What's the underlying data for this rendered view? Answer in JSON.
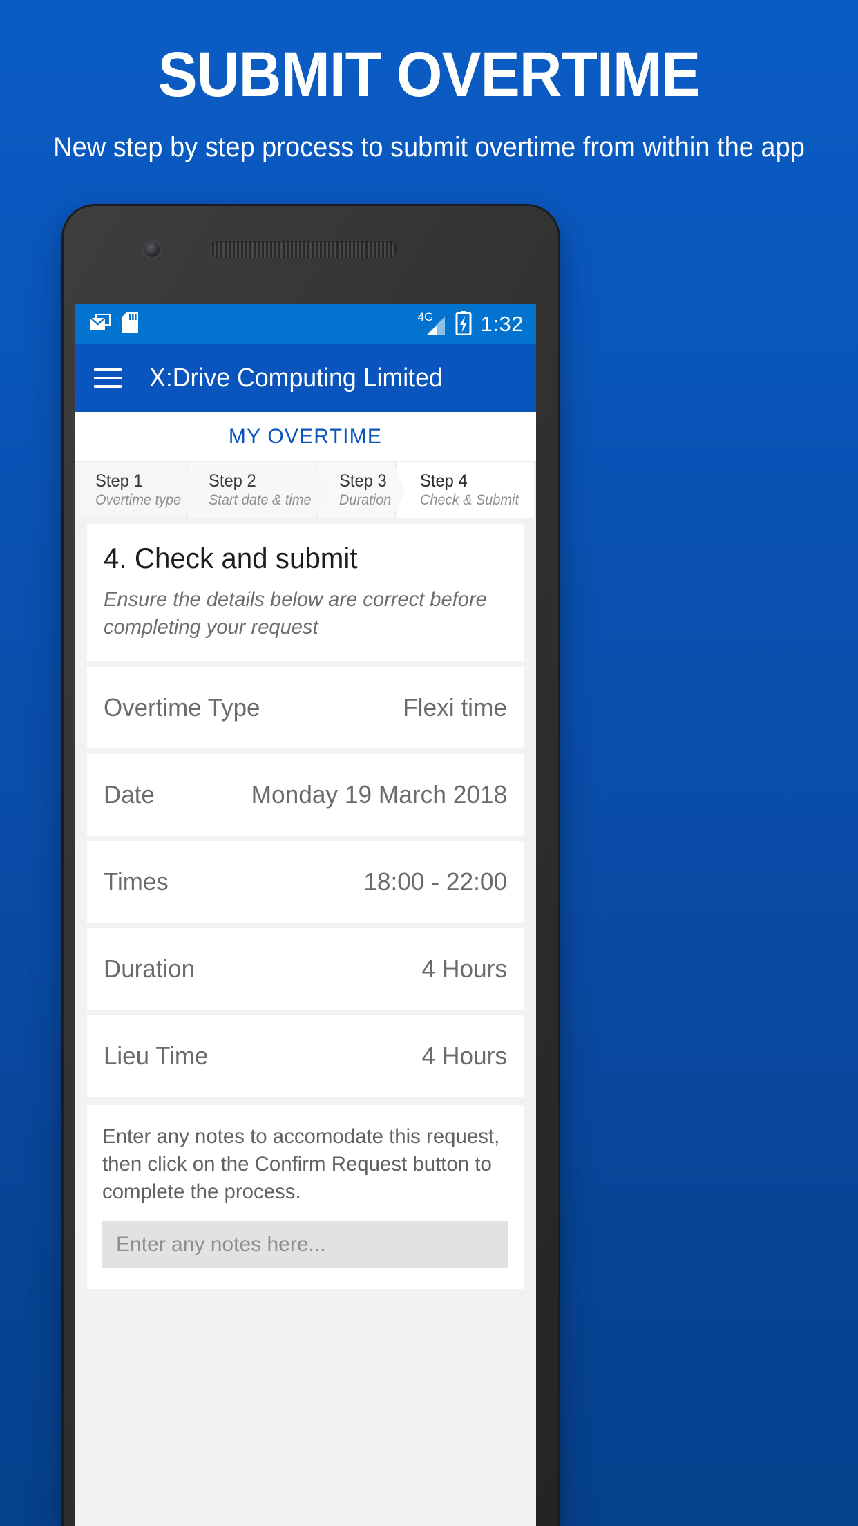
{
  "promo": {
    "title": "SUBMIT OVERTIME",
    "subtitle": "New step by step process to submit overtime from within the app"
  },
  "colors": {
    "background_top": "#0a5cc4",
    "background_bottom": "#06418d",
    "statusbar": "#0273ce",
    "appbar": "#0a55bd",
    "accent": "#0a55bd"
  },
  "phone": {
    "statusbar": {
      "icons_left": [
        "email-icon",
        "sd-card-icon"
      ],
      "network_label": "4G",
      "icons_right": [
        "signal-icon",
        "battery-charging-icon"
      ],
      "time": "1:32"
    },
    "appbar": {
      "menu_icon": "hamburger-menu-icon",
      "title": "X:Drive Computing Limited"
    },
    "tabs": [
      {
        "label": "MY OVERTIME",
        "active": true
      }
    ],
    "stepper": [
      {
        "number": "Step 1",
        "label": "Overtime type",
        "active": false
      },
      {
        "number": "Step 2",
        "label": "Start date & time",
        "active": false
      },
      {
        "number": "Step 3",
        "label": "Duration",
        "active": false
      },
      {
        "number": "Step 4",
        "label": "Check & Submit",
        "active": true
      }
    ],
    "section": {
      "title": "4. Check and submit",
      "subtitle": "Ensure the details below are correct before completing your request"
    },
    "summary_rows": [
      {
        "label": "Overtime Type",
        "value": "Flexi time"
      },
      {
        "label": "Date",
        "value": "Monday 19 March 2018"
      },
      {
        "label": "Times",
        "value": "18:00 - 22:00"
      },
      {
        "label": "Duration",
        "value": "4 Hours"
      },
      {
        "label": "Lieu Time",
        "value": "4 Hours"
      }
    ],
    "notes": {
      "instruction": "Enter any notes to accomodate this request, then click on the Confirm Request button to complete the process.",
      "placeholder": "Enter any notes here...",
      "value": ""
    }
  }
}
